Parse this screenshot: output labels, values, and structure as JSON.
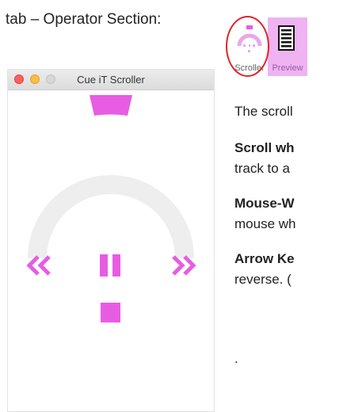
{
  "doc": {
    "intro": "tab – Operator Section:",
    "p1": "The scroll",
    "p2_bold": "Scroll wh",
    "p2_rest": "track to a",
    "p3_bold": "Mouse-W",
    "p3_rest": "mouse wh",
    "p4_bold": "Arrow Ke",
    "p4_rest": "reverse. (",
    "trailing": "."
  },
  "window": {
    "title": "Cue iT Scroller"
  },
  "toolbar": {
    "scroller_label": "Scroller",
    "preview_label": "Preview"
  },
  "icons": {
    "scroller_tab": "scroller-arc-icon",
    "preview_tab": "document-lines-icon",
    "rewind": "rewind-icon",
    "pause": "pause-icon",
    "fast_forward": "fast-forward-icon",
    "stop": "stop-icon"
  },
  "colors": {
    "accent": "#e85ce3",
    "arc_track": "#eeeeee",
    "highlight": "#e0242b",
    "preview_tab_bg": "#efb3f2"
  }
}
